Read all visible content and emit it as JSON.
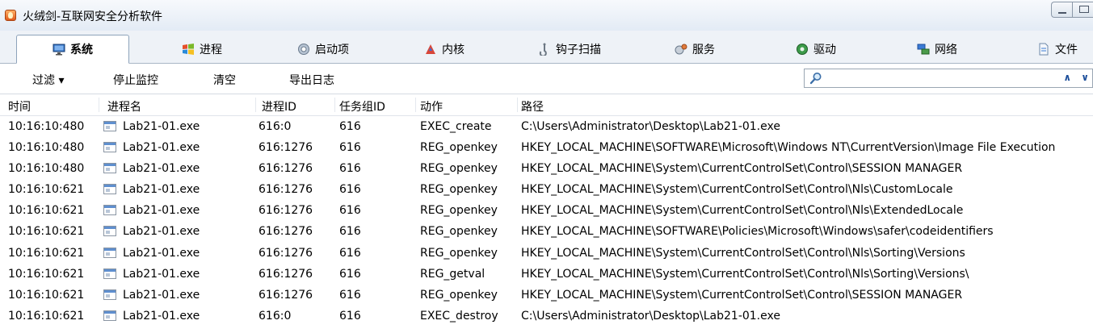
{
  "window": {
    "title": "火绒剑-互联网安全分析软件"
  },
  "tabs": [
    {
      "id": "system",
      "label": "系统",
      "icon": "monitor-icon",
      "active": true
    },
    {
      "id": "process",
      "label": "进程",
      "icon": "windows-flag-icon",
      "active": false
    },
    {
      "id": "startup",
      "label": "启动项",
      "icon": "gear-icon",
      "active": false
    },
    {
      "id": "kernel",
      "label": "内核",
      "icon": "kernel-icon",
      "active": false
    },
    {
      "id": "hook",
      "label": "钩子扫描",
      "icon": "hook-icon",
      "active": false
    },
    {
      "id": "services",
      "label": "服务",
      "icon": "services-icon",
      "active": false
    },
    {
      "id": "drivers",
      "label": "驱动",
      "icon": "driver-icon",
      "active": false
    },
    {
      "id": "network",
      "label": "网络",
      "icon": "network-icon",
      "active": false
    },
    {
      "id": "files",
      "label": "文件",
      "icon": "file-icon",
      "active": false
    }
  ],
  "toolbar": {
    "filter_label": "过滤 ▾",
    "stop_label": "停止监控",
    "clear_label": "清空",
    "export_label": "导出日志",
    "search_value": "",
    "search_placeholder": ""
  },
  "table": {
    "columns": [
      "时间",
      "进程名",
      "进程ID",
      "任务组ID",
      "动作",
      "路径"
    ],
    "rows": [
      {
        "time": "10:16:10:480",
        "process": "Lab21-01.exe",
        "pid": "616:0",
        "tgid": "616",
        "action": "EXEC_create",
        "path": "C:\\Users\\Administrator\\Desktop\\Lab21-01.exe"
      },
      {
        "time": "10:16:10:480",
        "process": "Lab21-01.exe",
        "pid": "616:1276",
        "tgid": "616",
        "action": "REG_openkey",
        "path": "HKEY_LOCAL_MACHINE\\SOFTWARE\\Microsoft\\Windows NT\\CurrentVersion\\Image File Execution"
      },
      {
        "time": "10:16:10:480",
        "process": "Lab21-01.exe",
        "pid": "616:1276",
        "tgid": "616",
        "action": "REG_openkey",
        "path": "HKEY_LOCAL_MACHINE\\System\\CurrentControlSet\\Control\\SESSION MANAGER"
      },
      {
        "time": "10:16:10:621",
        "process": "Lab21-01.exe",
        "pid": "616:1276",
        "tgid": "616",
        "action": "REG_openkey",
        "path": "HKEY_LOCAL_MACHINE\\System\\CurrentControlSet\\Control\\Nls\\CustomLocale"
      },
      {
        "time": "10:16:10:621",
        "process": "Lab21-01.exe",
        "pid": "616:1276",
        "tgid": "616",
        "action": "REG_openkey",
        "path": "HKEY_LOCAL_MACHINE\\System\\CurrentControlSet\\Control\\Nls\\ExtendedLocale"
      },
      {
        "time": "10:16:10:621",
        "process": "Lab21-01.exe",
        "pid": "616:1276",
        "tgid": "616",
        "action": "REG_openkey",
        "path": "HKEY_LOCAL_MACHINE\\SOFTWARE\\Policies\\Microsoft\\Windows\\safer\\codeidentifiers"
      },
      {
        "time": "10:16:10:621",
        "process": "Lab21-01.exe",
        "pid": "616:1276",
        "tgid": "616",
        "action": "REG_openkey",
        "path": "HKEY_LOCAL_MACHINE\\System\\CurrentControlSet\\Control\\Nls\\Sorting\\Versions"
      },
      {
        "time": "10:16:10:621",
        "process": "Lab21-01.exe",
        "pid": "616:1276",
        "tgid": "616",
        "action": "REG_getval",
        "path": "HKEY_LOCAL_MACHINE\\System\\CurrentControlSet\\Control\\Nls\\Sorting\\Versions\\"
      },
      {
        "time": "10:16:10:621",
        "process": "Lab21-01.exe",
        "pid": "616:1276",
        "tgid": "616",
        "action": "REG_openkey",
        "path": "HKEY_LOCAL_MACHINE\\System\\CurrentControlSet\\Control\\SESSION MANAGER"
      },
      {
        "time": "10:16:10:621",
        "process": "Lab21-01.exe",
        "pid": "616:0",
        "tgid": "616",
        "action": "EXEC_destroy",
        "path": "C:\\Users\\Administrator\\Desktop\\Lab21-01.exe"
      }
    ]
  },
  "colors": {
    "accent": "#1c4e9a",
    "tab_border": "#8ea3bb",
    "titlebar": "#e3ebf5"
  }
}
